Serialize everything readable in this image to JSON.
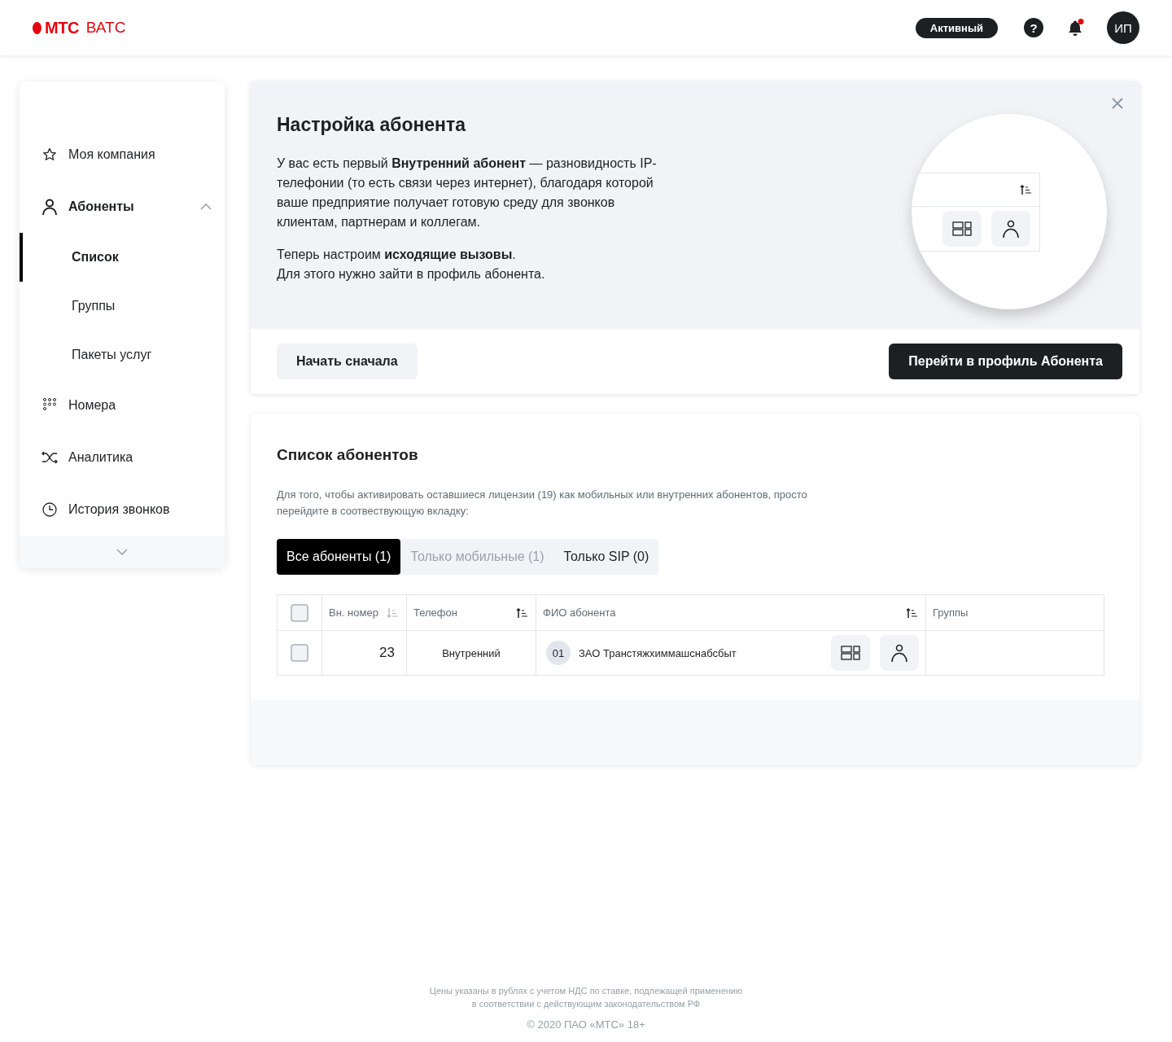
{
  "header": {
    "logo": "МТС",
    "product": "ВАТС",
    "status": "Активный",
    "help": "?",
    "notifications": {
      "unread": true
    },
    "avatar": "ИП"
  },
  "sidebar": {
    "items": [
      {
        "label": "Моя компания",
        "kind": "star",
        "expanded": false,
        "selected": false
      },
      {
        "label": "Абоненты",
        "kind": "user",
        "expanded": true,
        "selected": false,
        "children": [
          {
            "label": "Список",
            "selected": true
          },
          {
            "label": "Группы",
            "selected": false
          },
          {
            "label": "Пакеты услуг",
            "selected": false
          }
        ]
      },
      {
        "label": "Номера",
        "kind": "dots",
        "expanded": false,
        "selected": false
      },
      {
        "label": "Аналитика",
        "kind": "shuffle",
        "expanded": false,
        "selected": false
      },
      {
        "label": "История звонков",
        "kind": "clock",
        "expanded": false,
        "selected": false
      }
    ]
  },
  "onboarding": {
    "title": "Настройка абонента",
    "paragraphs": [
      "У вас есть первый **Внутренний абонент** — разновидность IP-телефонии (то есть связи через интернет), благодаря которой ваше предприятие получает готовую среду для звонков клиентам, партнерам и коллегам.",
      "Теперь настроим **исходящие вызовы**.\nДля этого нужно зайти в профиль абонента."
    ],
    "secondary_button": "Начать сначала",
    "primary_button": "Перейти в профиль Абонента"
  },
  "subscribers": {
    "title": "Список абонентов",
    "description": "Для того, чтобы активировать оставшиеся лицензии (19) как мобильных или внутренних абонентов, просто перейдите в соотвествующую вкладку:",
    "tabs": [
      {
        "label": "Все абоненты (1)",
        "selected": true,
        "disabled": false
      },
      {
        "label": "Только мобильные (1)",
        "selected": false,
        "disabled": true
      },
      {
        "label": "Только SIP (0)",
        "selected": false,
        "disabled": false
      }
    ],
    "table": {
      "columns": [
        {
          "kind": "checkbox",
          "checked": false
        },
        {
          "kind": "sortable",
          "label": "Вн. номер",
          "sorted": false
        },
        {
          "kind": "sortable",
          "label": "Телефон",
          "sorted": true
        },
        {
          "kind": "sortable",
          "label": "ФИО абонента",
          "sorted": true
        },
        {
          "kind": "text",
          "label": "Группы"
        }
      ],
      "rows": [
        {
          "checked": false,
          "number": "23",
          "phone": "Внутренний",
          "badge": "01",
          "name": "ЗАО Транстяжхиммашснабсбыт"
        }
      ]
    }
  },
  "footer": {
    "note": "Цены указаны в рублях с учетом НДС по ставке, подлежащей применению\nв соответствии с действующим законодательством РФ",
    "copyright": "© 2020 ПАО «МТС» 18+"
  }
}
